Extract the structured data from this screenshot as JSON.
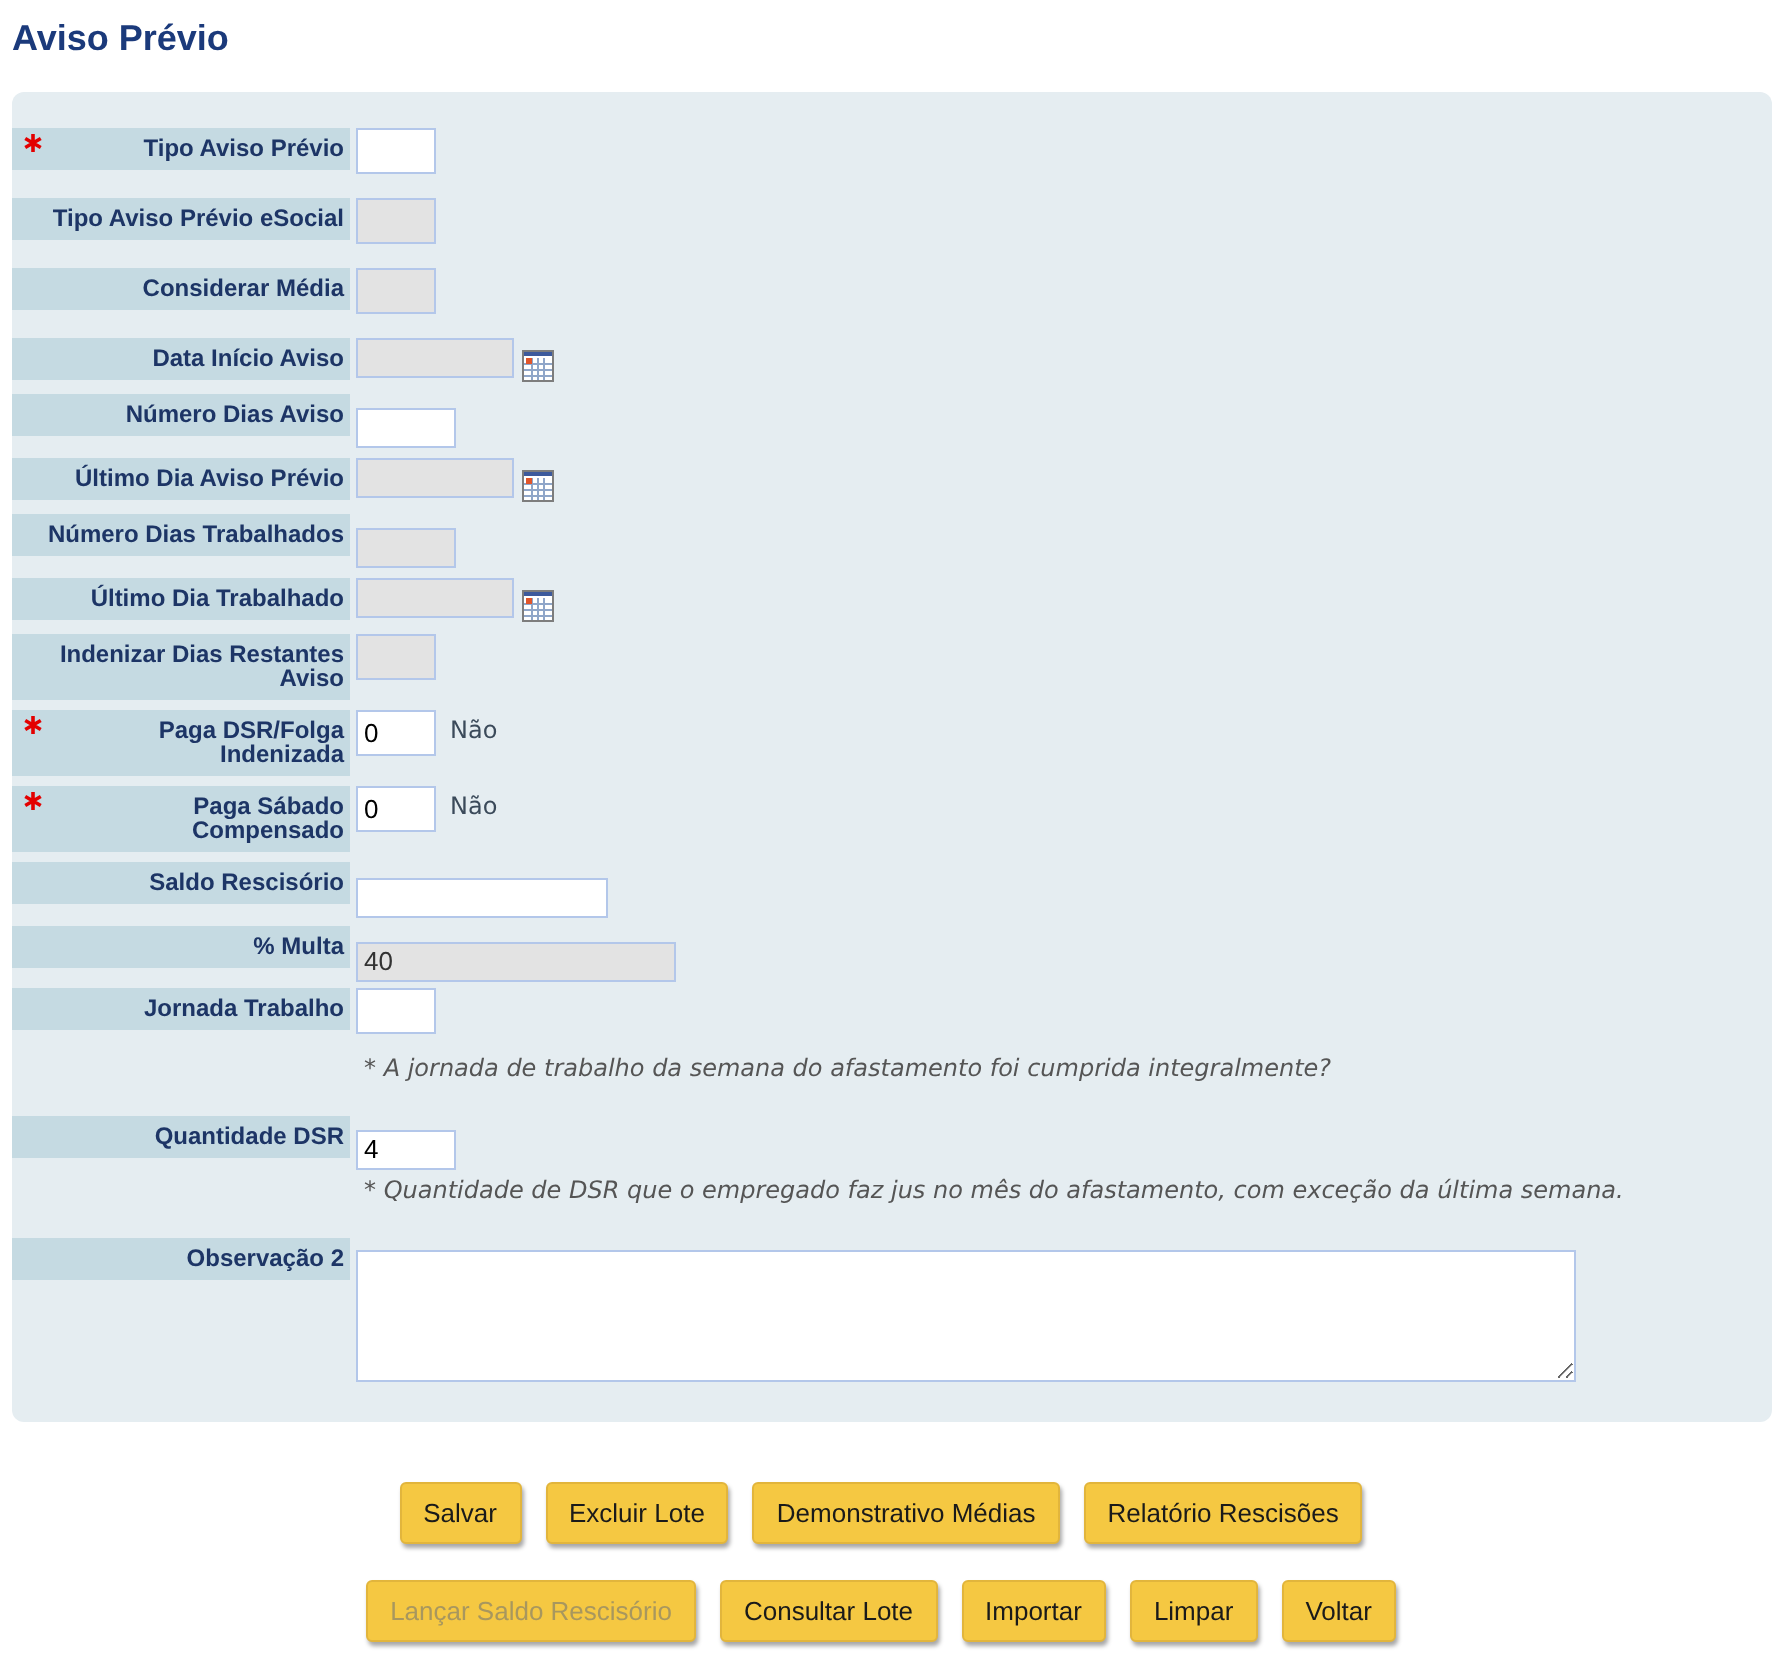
{
  "title": "Aviso Prévio",
  "fields": [
    {
      "label": "Tipo Aviso Prévio",
      "required": true,
      "kind": "code",
      "disabled": false
    },
    {
      "label": "Tipo Aviso Prévio eSocial",
      "required": false,
      "kind": "code",
      "disabled": true
    },
    {
      "label": "Considerar Média",
      "required": false,
      "kind": "code",
      "disabled": true
    },
    {
      "label": "Data Início Aviso",
      "required": false,
      "kind": "date",
      "disabled": true
    },
    {
      "label": "Número Dias Aviso",
      "required": false,
      "kind": "number",
      "disabled": false
    },
    {
      "label": "Último Dia Aviso Prévio",
      "required": false,
      "kind": "date",
      "disabled": true
    },
    {
      "label": "Número Dias Trabalhados",
      "required": false,
      "kind": "number",
      "disabled": true
    },
    {
      "label": "Último Dia Trabalhado",
      "required": false,
      "kind": "date",
      "disabled": true
    },
    {
      "label": "Indenizar Dias Restantes Aviso",
      "required": false,
      "kind": "code",
      "disabled": true
    },
    {
      "label": "Paga DSR/Folga Indenizada",
      "required": true,
      "kind": "code",
      "disabled": false,
      "value": "0",
      "suffix": "Não"
    },
    {
      "label": "Paga Sábado Compensado",
      "required": true,
      "kind": "code",
      "disabled": false,
      "value": "0",
      "suffix": "Não"
    },
    {
      "label": "Saldo Rescisório",
      "required": false,
      "kind": "amount",
      "disabled": false
    },
    {
      "label": "% Multa",
      "required": false,
      "kind": "percent",
      "disabled": true,
      "value": "40"
    },
    {
      "label": "Jornada Trabalho",
      "required": false,
      "kind": "code",
      "disabled": false,
      "hint": "* A jornada de trabalho da semana do afastamento foi cumprida integralmente?"
    },
    {
      "label": "Quantidade DSR",
      "required": false,
      "kind": "number",
      "disabled": false,
      "value": "4",
      "hint": "* Quantidade de DSR que o empregado faz jus no mês do afastamento, com exceção da última semana."
    },
    {
      "label": "Observação 2",
      "required": false,
      "kind": "memo",
      "disabled": false
    }
  ],
  "button_rows": [
    [
      {
        "label": "Salvar",
        "disabled": false
      },
      {
        "label": "Excluir Lote",
        "disabled": false
      },
      {
        "label": "Demonstrativo Médias",
        "disabled": false
      },
      {
        "label": "Relatório Rescisões",
        "disabled": false
      }
    ],
    [
      {
        "label": "Lançar Saldo Rescisório",
        "disabled": true
      },
      {
        "label": "Consultar Lote",
        "disabled": false
      },
      {
        "label": "Importar",
        "disabled": false
      },
      {
        "label": "Limpar",
        "disabled": false
      },
      {
        "label": "Voltar",
        "disabled": false
      }
    ]
  ]
}
